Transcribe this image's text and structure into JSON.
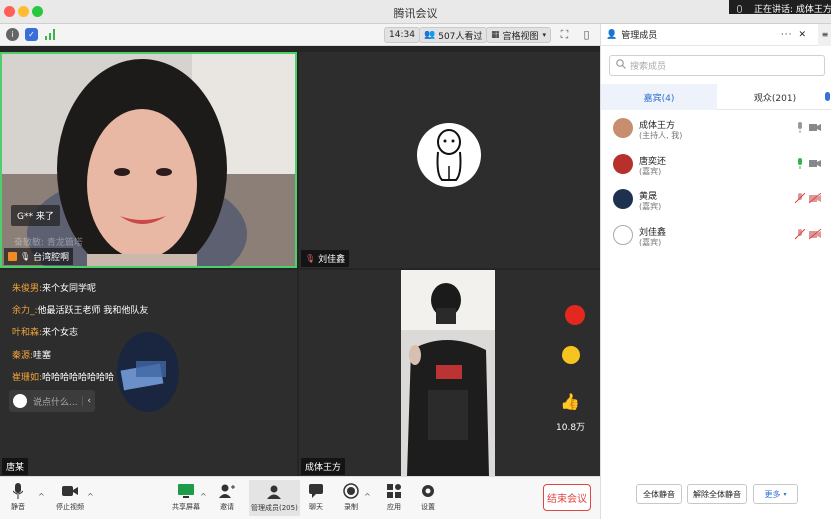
{
  "window": {
    "title": "腾讯会议",
    "speaking_text": "正在讲话: 成体王方;"
  },
  "toolbar": {
    "time": "14:34",
    "viewers": "507人看过",
    "view_mode": "宫格视图"
  },
  "colors": {
    "accent": "#2f6fd8",
    "speaking_border": "#4dcf6c",
    "danger": "#e0463f",
    "chat_name": "#f2a33b"
  },
  "tiles": {
    "tile1": {
      "toast": "G** 来了",
      "faded_text": "奋敏敏:  青龙篇塔",
      "name": "台湾腔啊"
    },
    "tile2": {
      "name": "刘佳鑫"
    },
    "tile3": {
      "name": "唐某"
    },
    "tile4": {
      "name": "成体王方",
      "likes": "10.8万"
    }
  },
  "chat": {
    "messages": [
      {
        "user": "朱俊男:",
        "text": "来个女同学呢"
      },
      {
        "user": "余力_:",
        "text": "他最活跃王老师 我和他队友"
      },
      {
        "user": "叶和森:",
        "text": "来个女志"
      },
      {
        "user": "秦源:",
        "text": "哇塞"
      },
      {
        "user": "崔珊如:",
        "text": "哈哈哈哈哈哈哈哈"
      }
    ],
    "input_placeholder": "说点什么..."
  },
  "bottombar": {
    "mute": "静音",
    "stop_video": "停止视频",
    "share": "共享屏幕",
    "invite": "邀请",
    "manage": "管理成员(205)",
    "chat": "聊天",
    "record": "录制",
    "apps": "应用",
    "settings": "设置",
    "end": "结束会议"
  },
  "panel": {
    "title": "管理成员",
    "search_placeholder": "搜索成员",
    "tab_guests": "嘉宾(4)",
    "tab_audience": "观众(201)",
    "members": [
      {
        "name": "成体王方",
        "role": "(主持人, 我)",
        "mic": "on-gray",
        "cam": "on"
      },
      {
        "name": "唐奕还",
        "role": "(嘉宾)",
        "mic": "on-green",
        "cam": "on"
      },
      {
        "name": "黄晟",
        "role": "(嘉宾)",
        "mic": "muted",
        "cam": "off"
      },
      {
        "name": "刘佳鑫",
        "role": "(嘉宾)",
        "mic": "muted",
        "cam": "off"
      }
    ],
    "mute_all": "全体静音",
    "unmute_all": "解除全体静音",
    "more": "更多"
  }
}
